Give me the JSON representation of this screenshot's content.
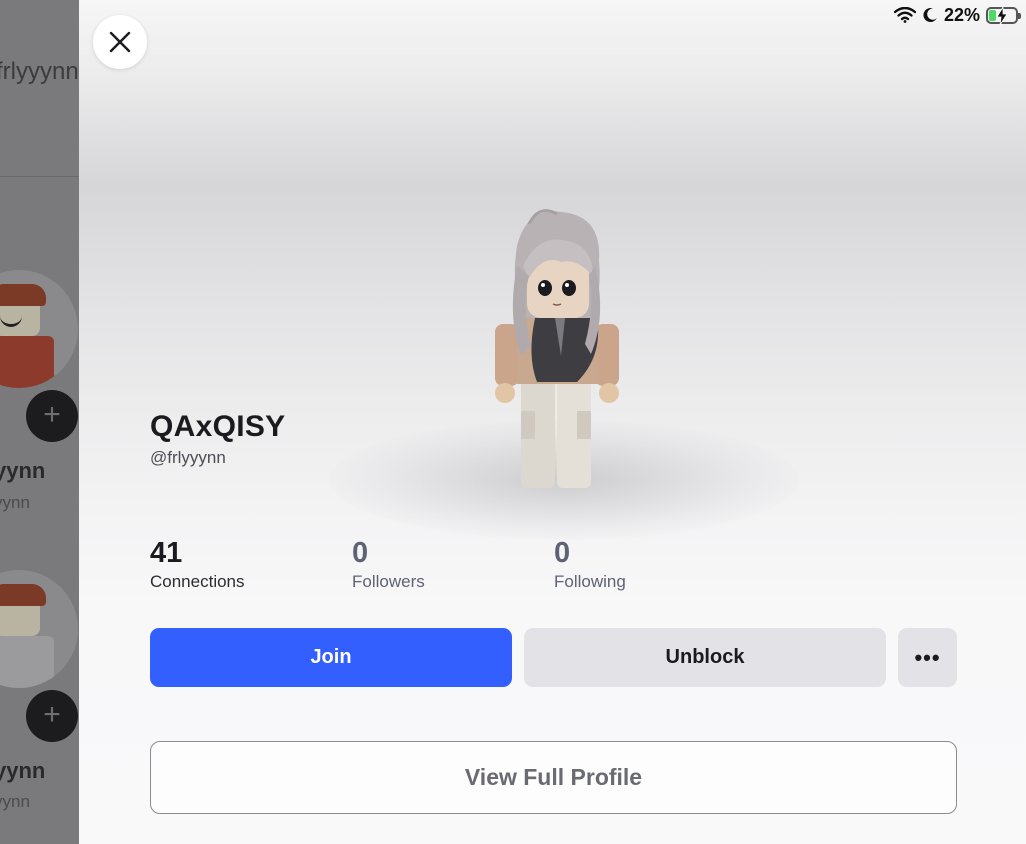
{
  "status_bar": {
    "battery": "22%"
  },
  "background_list": {
    "top_name": "frlyyynn",
    "users": [
      {
        "name": "yynn",
        "handle": "yynn"
      },
      {
        "name": "yynn",
        "handle": "yynn"
      }
    ],
    "add_symbol": "+"
  },
  "profile": {
    "display_name": "QAxQISY",
    "username": "@frlyyynn",
    "stats": [
      {
        "value": "41",
        "label": "Connections"
      },
      {
        "value": "0",
        "label": "Followers"
      },
      {
        "value": "0",
        "label": "Following"
      }
    ]
  },
  "actions": {
    "join_label": "Join",
    "unblock_label": "Unblock",
    "more_label": "•••",
    "view_profile_label": "View Full Profile"
  },
  "colors": {
    "primary": "#335fff",
    "secondary_button": "#e3e3e7",
    "battery_fill": "#4cd964"
  },
  "icons": [
    "close-icon",
    "wifi-icon",
    "moon-icon",
    "battery-icon",
    "plus-icon",
    "more-icon"
  ]
}
